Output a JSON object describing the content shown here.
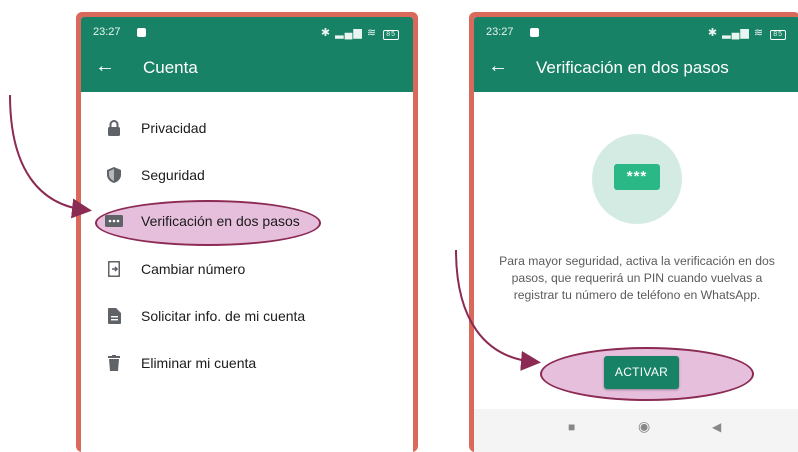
{
  "left_screen": {
    "status": {
      "time": "23:27",
      "battery": "85"
    },
    "appbar": {
      "back_icon": "arrow-left-icon",
      "title": "Cuenta"
    },
    "menu": [
      {
        "label": "Privacidad",
        "icon": "lock-icon"
      },
      {
        "label": "Seguridad",
        "icon": "shield-icon"
      },
      {
        "label": "Verificación en dos pasos",
        "icon": "dots-box-icon"
      },
      {
        "label": "Cambiar número",
        "icon": "phone-swap-icon"
      },
      {
        "label": "Solicitar info. de mi cuenta",
        "icon": "document-icon"
      },
      {
        "label": "Eliminar mi cuenta",
        "icon": "trash-icon"
      }
    ],
    "highlighted_item": "Verificación en dos pasos"
  },
  "right_screen": {
    "status": {
      "time": "23:27",
      "battery": "85"
    },
    "appbar": {
      "back_icon": "arrow-left-icon",
      "title": "Verificación en dos pasos"
    },
    "pin_graphic": "***",
    "description": "Para mayor seguridad, activa la verificación en dos pasos, que requerirá un PIN cuando vuelvas a registrar tu número de teléfono en WhatsApp.",
    "activate_button": "ACTIVAR",
    "navbar": {
      "square": "■",
      "circle": "◉",
      "back": "◀"
    }
  },
  "colors": {
    "frame": "#d9695a",
    "appbar": "#178265",
    "highlight_fill": "#e6bfdd",
    "highlight_stroke": "#8b2a53",
    "pin_green": "#2bb887"
  }
}
